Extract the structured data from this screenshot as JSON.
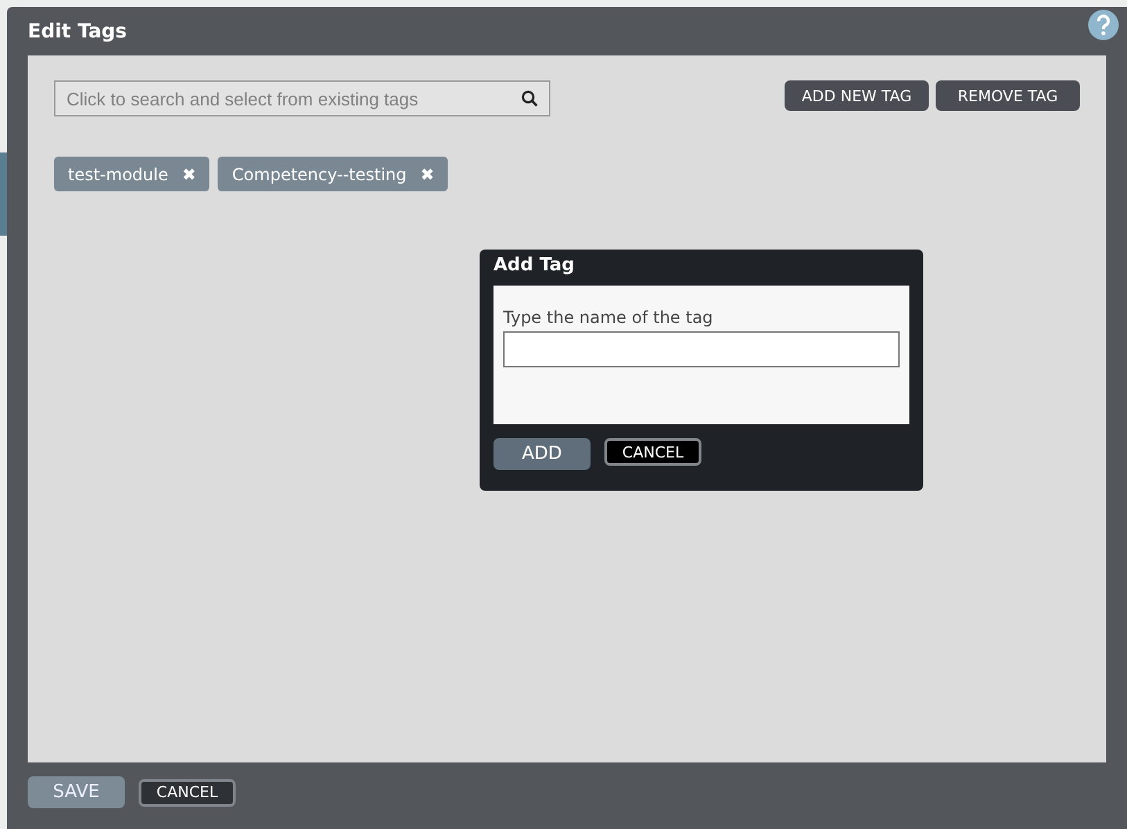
{
  "window": {
    "title": "Edit Tags"
  },
  "search": {
    "placeholder": "Click to search and select from existing tags"
  },
  "toolbar_buttons": [
    "ADD NEW TAG",
    "REMOVE TAG"
  ],
  "tags": [
    {
      "label": "test-module",
      "remove": "✖"
    },
    {
      "label": "Competency--testing",
      "remove": "✖"
    }
  ],
  "add_tag_dialog": {
    "title": "Add Tag",
    "field_label": "Type the name of the tag",
    "buttons": [
      {
        "label": "ADD",
        "kind": "primary"
      },
      {
        "label": "CANCEL",
        "kind": "outline"
      }
    ]
  },
  "footer_buttons": [
    {
      "label": "SAVE",
      "kind": "primary"
    },
    {
      "label": "CANCEL",
      "kind": "outline"
    }
  ]
}
